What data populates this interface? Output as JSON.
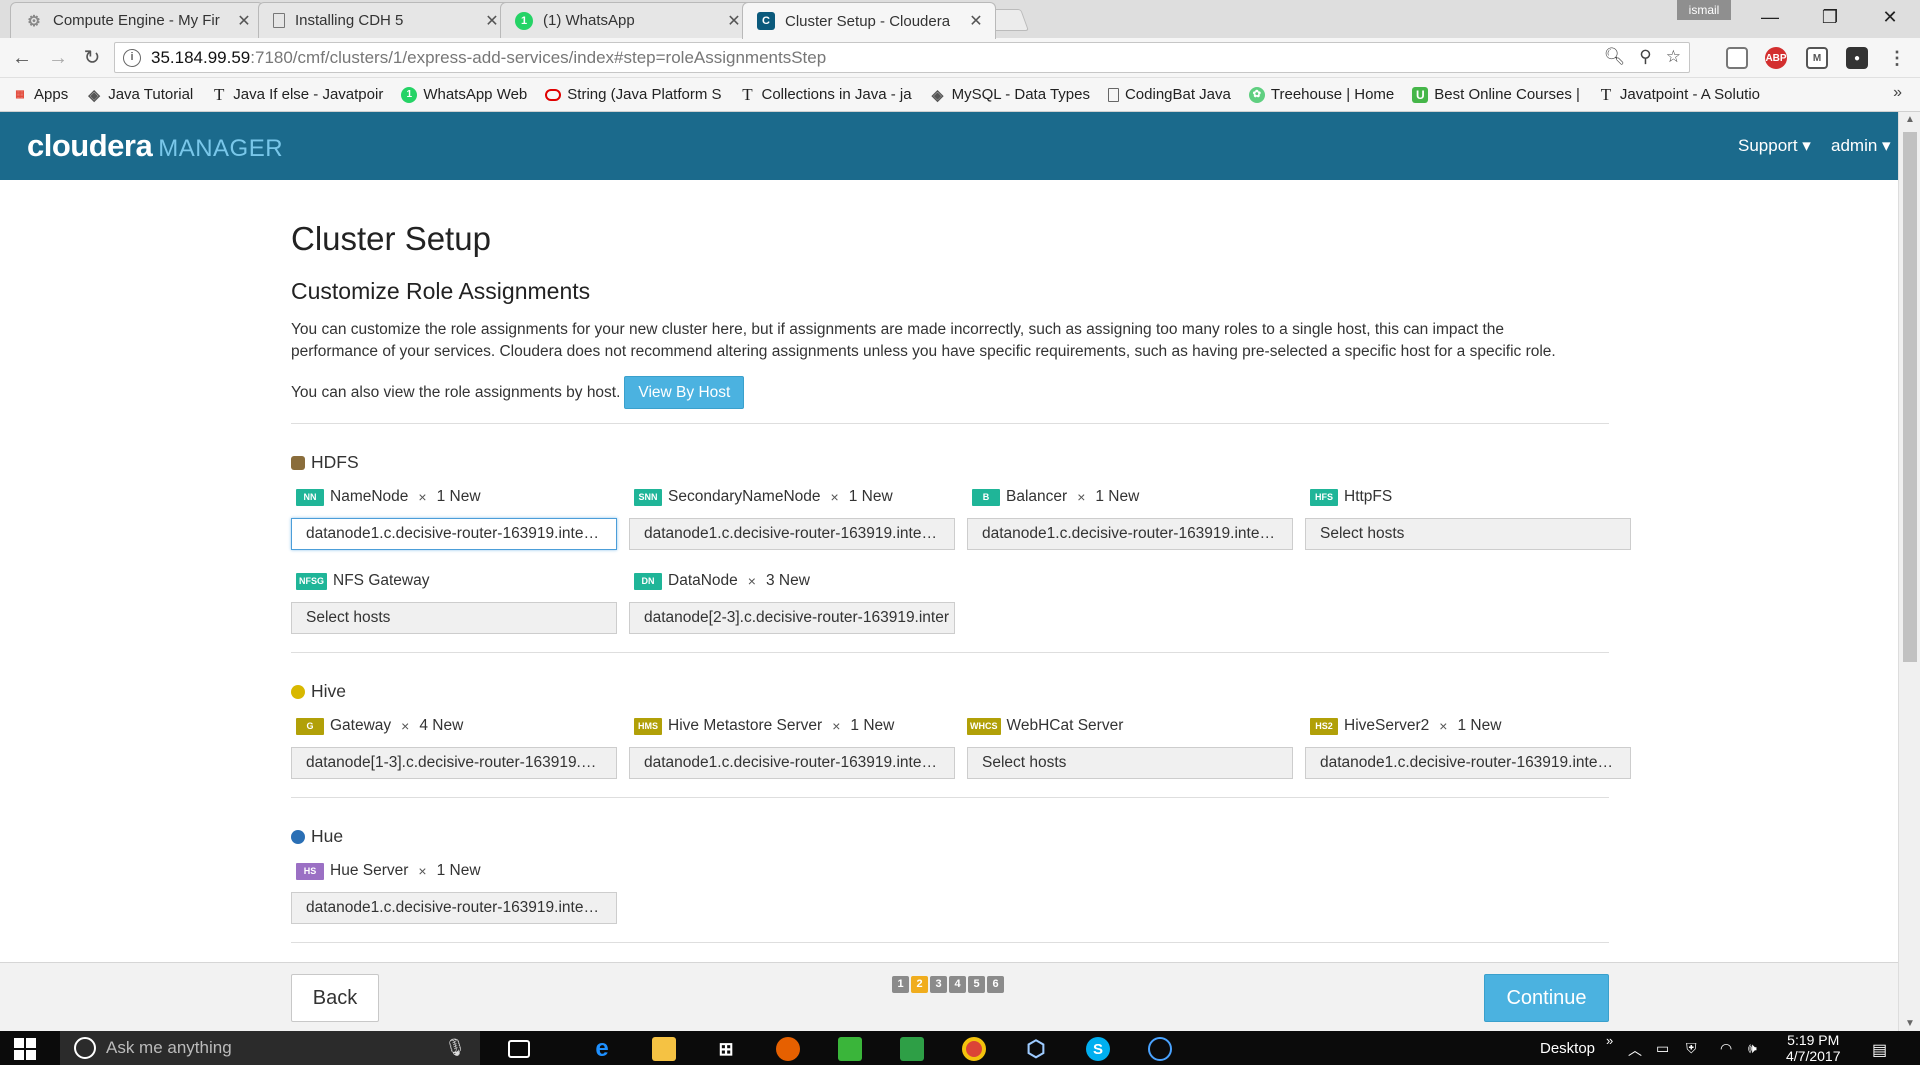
{
  "browser": {
    "tabs": [
      {
        "title": "Compute Engine - My Fir",
        "icon": "gear-icon",
        "color": "#9e9e9e",
        "glyph": "⚙",
        "active": false
      },
      {
        "title": "Installing CDH 5",
        "icon": "document-icon",
        "color": "#ffffff",
        "glyph": "▯",
        "active": false
      },
      {
        "title": "(1) WhatsApp",
        "icon": "whatsapp-icon",
        "color": "#25d366",
        "glyph": "1",
        "active": false
      },
      {
        "title": "Cluster Setup - Cloudera",
        "icon": "cloudera-icon",
        "color": "#0b5a7c",
        "glyph": "C",
        "active": true
      }
    ],
    "user_chip": "ismail",
    "url_host": "35.184.99.59",
    "url_path": ":7180/cmf/clusters/1/express-add-services/index#step=roleAssignmentsStep",
    "bookmarks": [
      {
        "label": "Apps",
        "icon": "apps-grid-icon",
        "glyph": "⋮⋮",
        "color": "#e34b3c"
      },
      {
        "label": "Java Tutorial",
        "icon": "diamond-icon",
        "glyph": "◈",
        "color": "#555555"
      },
      {
        "label": "Java If else - Javatpoir",
        "icon": "javatpoint-icon",
        "glyph": "T",
        "color": "#333333"
      },
      {
        "label": "WhatsApp Web",
        "icon": "whatsapp-icon",
        "glyph": "1",
        "color": "#25d366"
      },
      {
        "label": "String (Java Platform S",
        "icon": "oracle-icon",
        "glyph": "▭",
        "color": "#e00000"
      },
      {
        "label": "Collections in Java - ja",
        "icon": "javatpoint-icon",
        "glyph": "T",
        "color": "#333333"
      },
      {
        "label": "MySQL - Data Types",
        "icon": "diamond-icon",
        "glyph": "◈",
        "color": "#555555"
      },
      {
        "label": "CodingBat Java",
        "icon": "document-icon",
        "glyph": "▯",
        "color": "#555555"
      },
      {
        "label": "Treehouse | Home",
        "icon": "treehouse-icon",
        "glyph": "✿",
        "color": "#5fcf80"
      },
      {
        "label": "Best Online Courses |",
        "icon": "udemy-icon",
        "glyph": "U",
        "color": "#45b649"
      },
      {
        "label": "Javatpoint - A Solutio",
        "icon": "javatpoint-icon",
        "glyph": "T",
        "color": "#333333"
      }
    ]
  },
  "header": {
    "logo_main": "cloudera",
    "logo_sub": "MANAGER",
    "support_label": "Support ▾",
    "admin_label": "admin ▾"
  },
  "page": {
    "title": "Cluster Setup",
    "section_title": "Customize Role Assignments",
    "intro_line1": "You can customize the role assignments for your new cluster here, but if assignments are made incorrectly, such as assigning too many roles to a single host, this can impact the",
    "intro_line2": "performance of your services. Cloudera does not recommend altering assignments unless you have specific requirements, such as having pre-selected a specific host for a specific role.",
    "view_text": "You can also view the role assignments by host.",
    "view_button": "View By Host"
  },
  "services": [
    {
      "name": "HDFS",
      "icon": "hdfs-icon",
      "icon_color": "#8a6d3b",
      "roles": [
        {
          "badge": "NN",
          "badge_color": "#1fb598",
          "name": "NameNode",
          "count": "1 New",
          "hosts": "datanode1.c.decisive-router-163919.inte…",
          "focused": true
        },
        {
          "badge": "SNN",
          "badge_color": "#1fb598",
          "name": "SecondaryNameNode",
          "count": "1 New",
          "hosts": "datanode1.c.decisive-router-163919.inte…"
        },
        {
          "badge": "B",
          "badge_color": "#1fb598",
          "name": "Balancer",
          "count": "1 New",
          "hosts": "datanode1.c.decisive-router-163919.inte…"
        },
        {
          "badge": "HFS",
          "badge_color": "#1fb598",
          "name": "HttpFS",
          "count": "",
          "hosts": "Select hosts"
        },
        {
          "badge": "NFSG",
          "badge_color": "#1fb598",
          "name": "NFS Gateway",
          "count": "",
          "hosts": "Select hosts"
        },
        {
          "badge": "DN",
          "badge_color": "#1fb598",
          "name": "DataNode",
          "count": "3 New",
          "hosts": "datanode[2-3].c.decisive-router-163919.inter"
        }
      ]
    },
    {
      "name": "Hive",
      "icon": "hive-bee-icon",
      "icon_color": "#d8b800",
      "roles": [
        {
          "badge": "G",
          "badge_color": "#b1a008",
          "name": "Gateway",
          "count": "4 New",
          "hosts": "datanode[1-3].c.decisive-router-163919.…"
        },
        {
          "badge": "HMS",
          "badge_color": "#b1a008",
          "name": "Hive Metastore Server",
          "count": "1 New",
          "hosts": "datanode1.c.decisive-router-163919.inte…"
        },
        {
          "badge": "WHCS",
          "badge_color": "#b1a008",
          "name": "WebHCat Server",
          "count": "",
          "hosts": "Select hosts"
        },
        {
          "badge": "HS2",
          "badge_color": "#b1a008",
          "name": "HiveServer2",
          "count": "1 New",
          "hosts": "datanode1.c.decisive-router-163919.inte…"
        }
      ]
    },
    {
      "name": "Hue",
      "icon": "hue-icon",
      "icon_color": "#2a6fb5",
      "roles": [
        {
          "badge": "HS",
          "badge_color": "#9b70c4",
          "name": "Hue Server",
          "count": "1 New",
          "hosts": "datanode1.c.decisive-router-163919.inte…"
        }
      ]
    }
  ],
  "footer": {
    "back_label": "Back",
    "continue_label": "Continue",
    "steps": [
      "1",
      "2",
      "3",
      "4",
      "5",
      "6"
    ],
    "current_step": "2"
  },
  "taskbar": {
    "search_placeholder": "Ask me anything",
    "desktop_label": "Desktop",
    "time": "5:19 PM",
    "date": "4/7/2017"
  },
  "colors": {
    "header_bg": "#1b6a8c",
    "accent": "#4bb2e0",
    "step_current": "#f0ad1e"
  }
}
